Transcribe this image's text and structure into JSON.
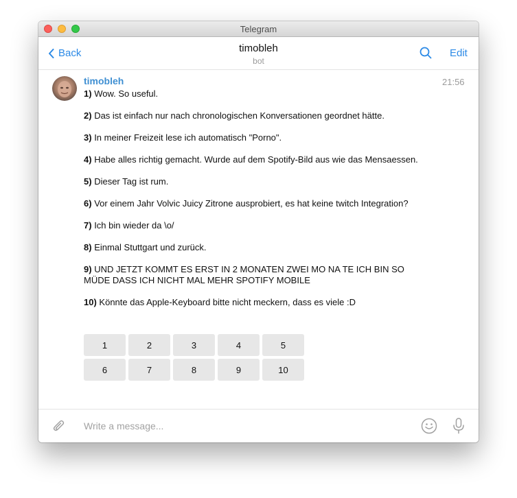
{
  "window": {
    "title": "Telegram"
  },
  "header": {
    "back_label": "Back",
    "chat_title": "timobleh",
    "chat_subtitle": "bot",
    "edit_label": "Edit"
  },
  "message": {
    "sender": "timobleh",
    "time": "21:56",
    "items": [
      {
        "num": "1)",
        "text": "Wow. So useful."
      },
      {
        "num": "2)",
        "text": "Das ist einfach nur nach chronologischen Konversationen geordnet hätte."
      },
      {
        "num": "3)",
        "text": "In meiner Freizeit lese ich automatisch \"Porno\"."
      },
      {
        "num": "4)",
        "text": "Habe alles richtig gemacht. Wurde auf dem Spotify-Bild aus wie das Mensaessen."
      },
      {
        "num": "5)",
        "text": "Dieser Tag ist rum."
      },
      {
        "num": "6)",
        "text": "Vor einem Jahr Volvic Juicy Zitrone ausprobiert, es hat keine twitch Integration?"
      },
      {
        "num": "7)",
        "text": "Ich bin wieder da \\o/"
      },
      {
        "num": "8)",
        "text": "Einmal Stuttgart und zurück."
      },
      {
        "num": "9)",
        "text": "UND JETZT KOMMT ES ERST IN 2 MONATEN ZWEI MO NA TE ICH BIN SO MÜDE DASS ICH NICHT MAL MEHR SPOTIFY MOBILE"
      },
      {
        "num": "10)",
        "text": "Könnte das Apple-Keyboard bitte nicht meckern, dass es viele :D"
      }
    ]
  },
  "keyboard": {
    "rows": [
      [
        "1",
        "2",
        "3",
        "4",
        "5"
      ],
      [
        "6",
        "7",
        "8",
        "9",
        "10"
      ]
    ]
  },
  "composer": {
    "placeholder": "Write a message..."
  },
  "icons": {
    "back": "chevron-left-icon",
    "search": "search-icon",
    "attach": "paperclip-icon",
    "emoji": "smiley-icon",
    "mic": "microphone-icon"
  },
  "colors": {
    "accent": "#2c8ae6",
    "sender": "#3f8fd2",
    "muted": "#9a9a9a",
    "keyboard_button": "#e7e7e7"
  }
}
